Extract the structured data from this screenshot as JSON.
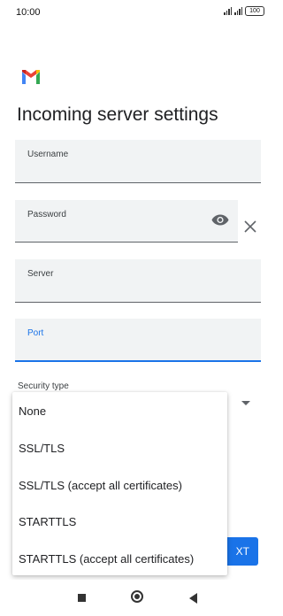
{
  "status_bar": {
    "time": "10:00",
    "battery": "100"
  },
  "page": {
    "title": "Incoming server settings"
  },
  "fields": {
    "username": {
      "label": "Username",
      "value": ""
    },
    "password": {
      "label": "Password",
      "value": ""
    },
    "server": {
      "label": "Server",
      "value": ""
    },
    "port": {
      "label": "Port",
      "value": ""
    }
  },
  "security": {
    "label": "Security type",
    "options": [
      "None",
      "SSL/TLS",
      "SSL/TLS (accept all certificates)",
      "STARTTLS",
      "STARTTLS (accept all certificates)"
    ]
  },
  "actions": {
    "next_label": "XT"
  },
  "icons": {
    "logo": "gmail-logo-icon",
    "password_toggle": "eye-icon",
    "clear": "close-icon",
    "dropdown": "caret-down-icon",
    "nav_recent": "square-icon",
    "nav_home": "circle-icon",
    "nav_back": "triangle-back-icon"
  },
  "colors": {
    "accent": "#1a73e8",
    "field_bg": "#f1f3f4",
    "gmail_red": "#ea4335"
  }
}
